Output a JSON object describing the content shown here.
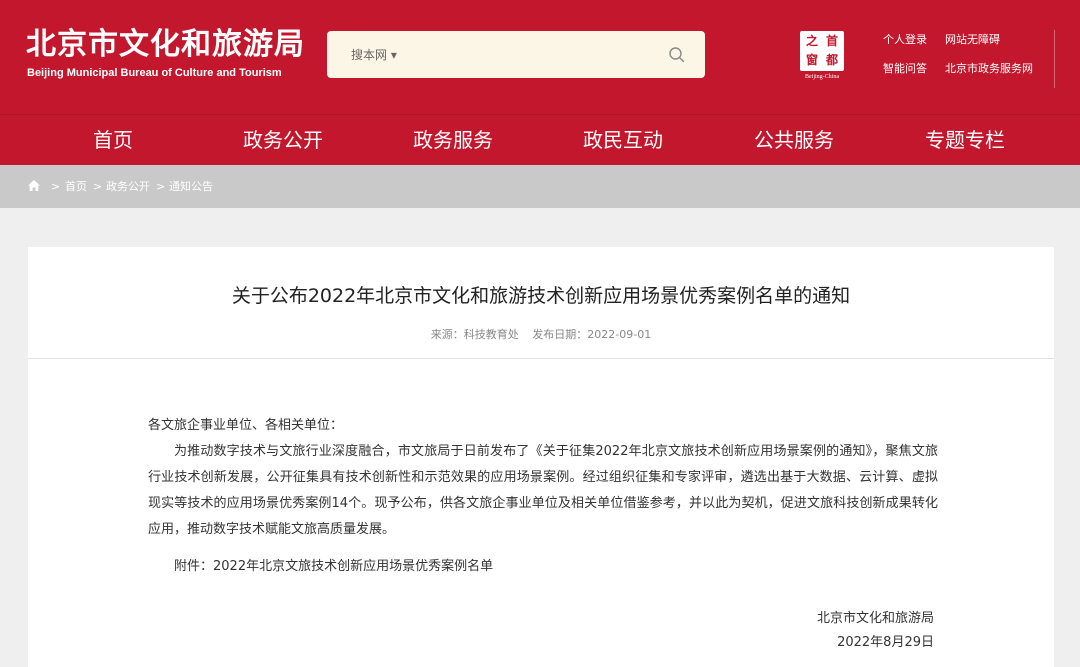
{
  "header": {
    "logo_cn": "北京市文化和旅游局",
    "logo_en": "Beijing Municipal Bureau of Culture and Tourism",
    "search": {
      "scope_label": "搜本网 ▾",
      "placeholder": ""
    },
    "seal": {
      "chars": [
        "之",
        "首",
        "窗",
        "都"
      ],
      "subtitle": "Beijing-China"
    },
    "top_links": [
      "个人登录",
      "网站无障碍",
      "智能问答",
      "北京市政务服务网"
    ],
    "brand_color": "#c2172d"
  },
  "nav": {
    "items": [
      "首页",
      "政务公开",
      "政务服务",
      "政民互动",
      "公共服务",
      "专题专栏"
    ]
  },
  "breadcrumb": {
    "separator": ">",
    "items": [
      "首页",
      "政务公开",
      "通知公告"
    ]
  },
  "article": {
    "title": "关于公布2022年北京市文化和旅游技术创新应用场景优秀案例名单的通知",
    "source": "来源：科技教育处",
    "date": "发布日期：2022-09-01",
    "salutation": "各文旅企事业单位、各相关单位：",
    "paragraph": "为推动数字技术与文旅行业深度融合，市文旅局于日前发布了《关于征集2022年北京文旅技术创新应用场景案例的通知》，聚焦文旅行业技术创新发展，公开征集具有技术创新性和示范效果的应用场景案例。经过组织征集和专家评审，遴选出基于大数据、云计算、虚拟现实等技术的应用场景优秀案例14个。现予公布，供各文旅企事业单位及相关单位借鉴参考，并以此为契机，促进文旅科技创新成果转化应用，推动数字技术赋能文旅高质量发展。",
    "attachment": "附件：2022年北京文旅技术创新应用场景优秀案例名单",
    "signature_org": "北京市文化和旅游局",
    "signature_date": "2022年8月29日"
  }
}
